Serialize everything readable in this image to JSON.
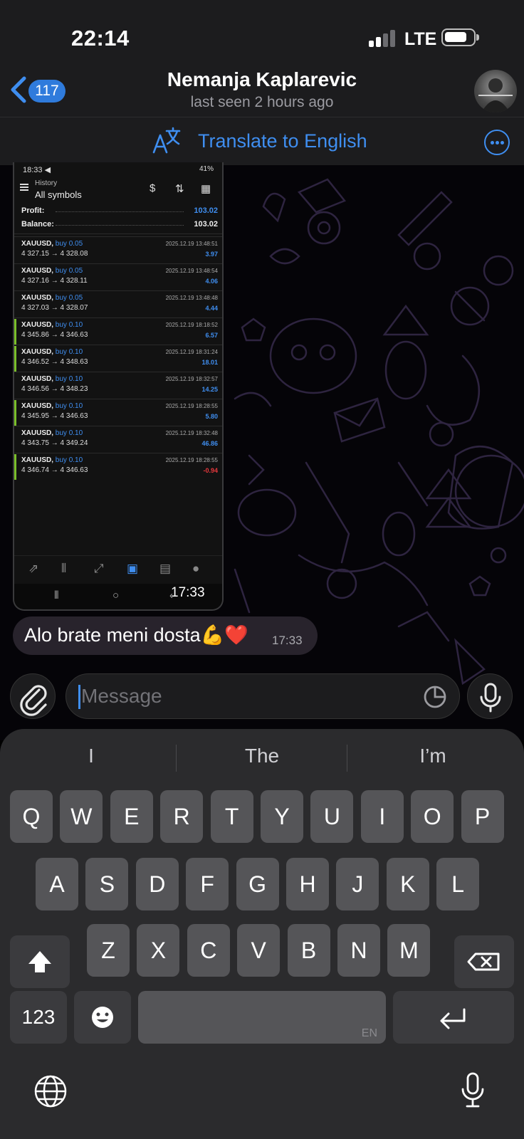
{
  "status": {
    "time": "22:14",
    "network": "LTE"
  },
  "header": {
    "back_count": "117",
    "name": "Nemanja Kaplarevic",
    "subtitle": "last seen 2 hours ago",
    "translate_label": "Translate to English"
  },
  "shot": {
    "status_time": "18:33 ◀",
    "status_right": "41%",
    "title_small": "History",
    "title": "All symbols",
    "profit_label": "Profit:",
    "profit_value": "103.02",
    "balance_label": "Balance:",
    "balance_value": "103.02",
    "trades": [
      {
        "symbol": "XAUUSD,",
        "action": "buy 0.05",
        "prices": "4 327.15 → 4 328.08",
        "date": "2025.12.19 13:48:51",
        "pl": "3.97",
        "mark": false,
        "neg": false
      },
      {
        "symbol": "XAUUSD,",
        "action": "buy 0.05",
        "prices": "4 327.16 → 4 328.11",
        "date": "2025.12.19 13:48:54",
        "pl": "4.06",
        "mark": false,
        "neg": false
      },
      {
        "symbol": "XAUUSD,",
        "action": "buy 0.05",
        "prices": "4 327.03 → 4 328.07",
        "date": "2025.12.19 13:48:48",
        "pl": "4.44",
        "mark": false,
        "neg": false
      },
      {
        "symbol": "XAUUSD,",
        "action": "buy 0.10",
        "prices": "4 345.86 → 4 346.63",
        "date": "2025.12.19 18:18:52",
        "pl": "6.57",
        "mark": true,
        "neg": false
      },
      {
        "symbol": "XAUUSD,",
        "action": "buy 0.10",
        "prices": "4 346.52 → 4 348.63",
        "date": "2025.12.19 18:31:24",
        "pl": "18.01",
        "mark": true,
        "neg": false
      },
      {
        "symbol": "XAUUSD,",
        "action": "buy 0.10",
        "prices": "4 346.56 → 4 348.23",
        "date": "2025.12.19 18:32:57",
        "pl": "14.25",
        "mark": false,
        "neg": false
      },
      {
        "symbol": "XAUUSD,",
        "action": "buy 0.10",
        "prices": "4 345.95 → 4 346.63",
        "date": "2025.12.19 18:28:55",
        "pl": "5.80",
        "mark": true,
        "neg": false
      },
      {
        "symbol": "XAUUSD,",
        "action": "buy 0.10",
        "prices": "4 343.75 → 4 349.24",
        "date": "2025.12.19 18:32:48",
        "pl": "46.86",
        "mark": false,
        "neg": false
      },
      {
        "symbol": "XAUUSD,",
        "action": "buy 0.10",
        "prices": "4 346.74 → 4 346.63",
        "date": "2025.12.19 18:28:55",
        "pl": "-0.94",
        "mark": true,
        "neg": true
      }
    ],
    "time": "17:33"
  },
  "message": {
    "text": "Alo brate meni dosta💪❤️",
    "time": "17:33"
  },
  "input": {
    "placeholder": "Message"
  },
  "keyboard": {
    "suggestions": [
      "I",
      "The",
      "I’m"
    ],
    "row1": [
      "Q",
      "W",
      "E",
      "R",
      "T",
      "Y",
      "U",
      "I",
      "O",
      "P"
    ],
    "row2": [
      "A",
      "S",
      "D",
      "F",
      "G",
      "H",
      "J",
      "K",
      "L"
    ],
    "row3": [
      "Z",
      "X",
      "C",
      "V",
      "B",
      "N",
      "M"
    ],
    "numbers_label": "123",
    "space_lang": "EN"
  },
  "colors": {
    "accent": "#3f8ef0",
    "profit_green_mark": "#7bbf2a",
    "loss_red": "#e8383d"
  }
}
